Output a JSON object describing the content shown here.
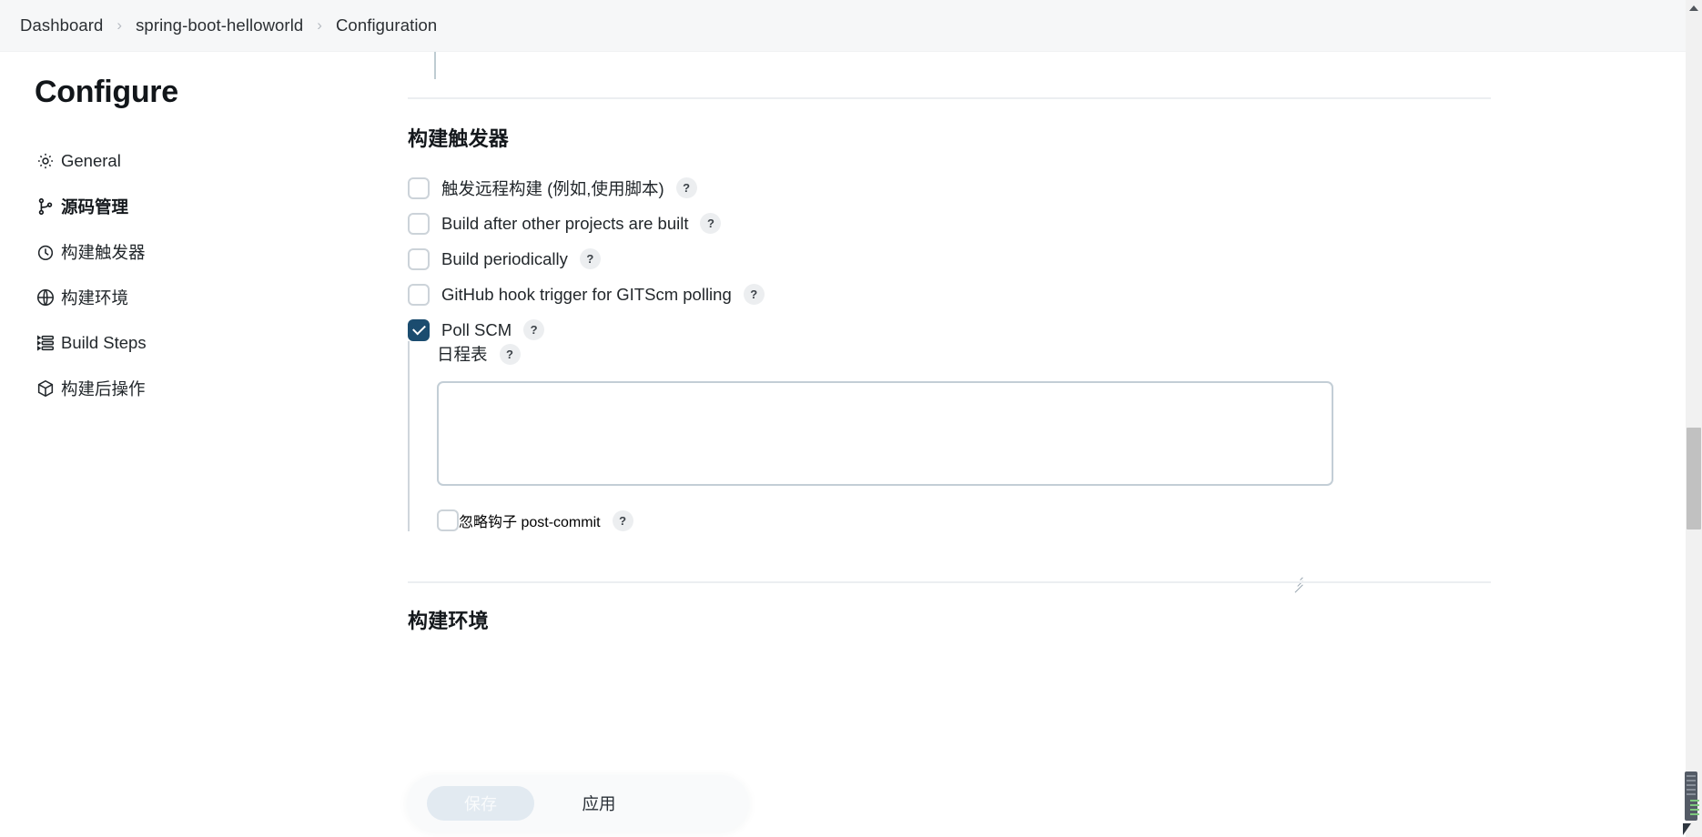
{
  "breadcrumb": {
    "items": [
      {
        "label": "Dashboard"
      },
      {
        "label": "spring-boot-helloworld"
      },
      {
        "label": "Configuration"
      }
    ],
    "separator": "›"
  },
  "sidebar": {
    "title": "Configure",
    "items": [
      {
        "label": "General",
        "icon": "gear-icon",
        "active": false
      },
      {
        "label": "源码管理",
        "icon": "source-branch-icon",
        "active": true
      },
      {
        "label": "构建触发器",
        "icon": "clock-icon",
        "active": false
      },
      {
        "label": "构建环境",
        "icon": "globe-icon",
        "active": false
      },
      {
        "label": "Build Steps",
        "icon": "list-steps-icon",
        "active": false
      },
      {
        "label": "构建后操作",
        "icon": "package-icon",
        "active": false
      }
    ]
  },
  "main": {
    "triggers_heading": "构建触发器",
    "environment_heading": "构建环境",
    "help_badge": "?",
    "triggers": [
      {
        "label": "触发远程构建 (例如,使用脚本)",
        "checked": false
      },
      {
        "label": "Build after other projects are built",
        "checked": false
      },
      {
        "label": "Build periodically",
        "checked": false
      },
      {
        "label": "GitHub hook trigger for GITScm polling",
        "checked": false
      },
      {
        "label": "Poll SCM",
        "checked": true
      }
    ],
    "poll_scm": {
      "schedule_label": "日程表",
      "schedule_value": "",
      "schedule_placeholder": "",
      "ignore_post_commit_label": "忽略钩子 post-commit",
      "ignore_post_commit_checked": false
    }
  },
  "footer": {
    "save_label": "保存",
    "apply_label": "应用"
  },
  "colors": {
    "checkbox_checked": "#1b4c6f",
    "breadcrumb_bg": "#f6f7f8",
    "textarea_border": "#c3ced6",
    "scrollbar_thumb": "#c1c1c1"
  }
}
